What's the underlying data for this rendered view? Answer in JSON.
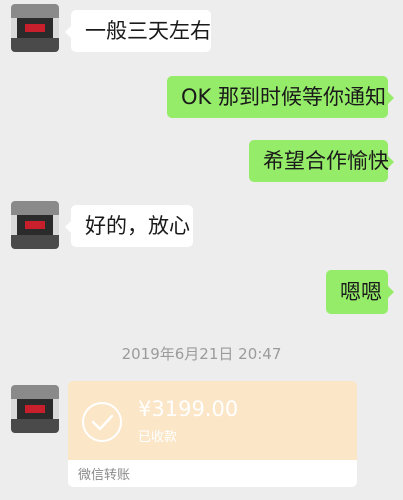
{
  "messages": [
    {
      "text": "一般三天左右"
    },
    {
      "text": "OK 那到时候等你通知"
    },
    {
      "text": "希望合作愉快"
    },
    {
      "text": "好的，放心"
    },
    {
      "text": "嗯嗯"
    }
  ],
  "timestamp": "2019年6月21日 20:47",
  "transfer": {
    "amount": "¥3199.00",
    "status": "已收款",
    "label": "微信转账"
  },
  "colors": {
    "background": "#ededed",
    "outgoing_bubble": "#95ec69",
    "incoming_bubble": "#ffffff",
    "transfer_card": "#fbe6c8"
  },
  "icons": [
    "contact-avatar",
    "check-icon"
  ]
}
